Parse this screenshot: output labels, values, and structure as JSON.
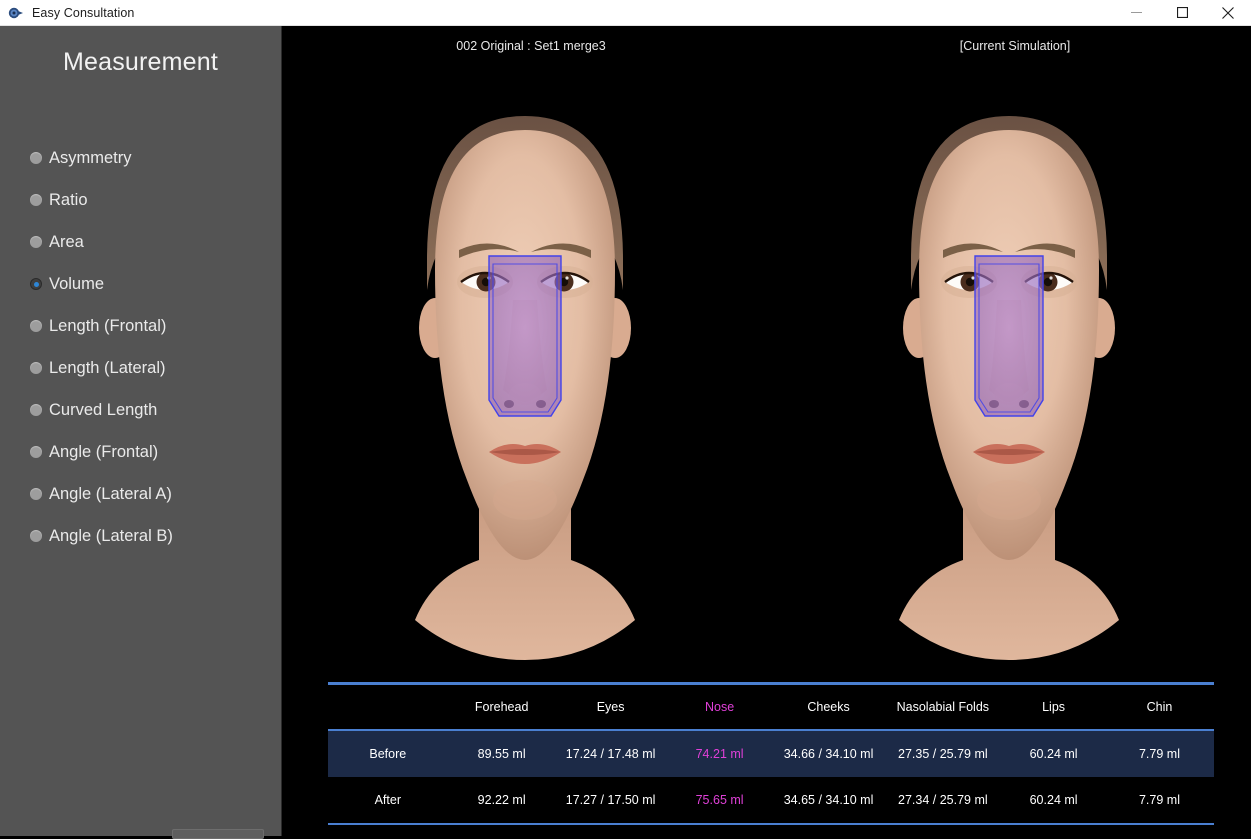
{
  "window": {
    "title": "Easy Consultation",
    "app_icon": "app-logo-icon",
    "minimize_label": "—",
    "maximize_label": "□",
    "close_label": "✕"
  },
  "sidebar": {
    "title": "Measurement",
    "items": [
      {
        "label": "Asymmetry",
        "selected": false
      },
      {
        "label": "Ratio",
        "selected": false
      },
      {
        "label": "Area",
        "selected": false
      },
      {
        "label": "Volume",
        "selected": true
      },
      {
        "label": "Length (Frontal)",
        "selected": false
      },
      {
        "label": "Length (Lateral)",
        "selected": false
      },
      {
        "label": "Curved Length",
        "selected": false
      },
      {
        "label": "Angle (Frontal)",
        "selected": false
      },
      {
        "label": "Angle (Lateral A)",
        "selected": false
      },
      {
        "label": "Angle (Lateral B)",
        "selected": false
      }
    ]
  },
  "viewport": {
    "left_title": "002 Original : Set1 merge3",
    "right_title": "[Current Simulation]",
    "overlay_region": "nose",
    "overlay_fill": "#9b6fc0",
    "overlay_stroke": "#4040e8"
  },
  "table": {
    "rule_color": "#4a7fd1",
    "highlight_color": "#e040d8",
    "selected_row_bg": "#1c2a47",
    "columns": [
      "",
      "Forehead",
      "Eyes",
      "Nose",
      "Cheeks",
      "Nasolabial Folds",
      "Lips",
      "Chin"
    ],
    "highlighted_column": "Nose",
    "rows": [
      {
        "label": "Before",
        "selected": true,
        "values": [
          "89.55 ml",
          "17.24 / 17.48 ml",
          "74.21 ml",
          "34.66 / 34.10 ml",
          "27.35 / 25.79 ml",
          "60.24 ml",
          "7.79 ml"
        ]
      },
      {
        "label": "After",
        "selected": false,
        "values": [
          "92.22 ml",
          "17.27 / 17.50 ml",
          "75.65 ml",
          "34.65 / 34.10 ml",
          "27.34 / 25.79 ml",
          "60.24 ml",
          "7.79 ml"
        ]
      }
    ]
  }
}
